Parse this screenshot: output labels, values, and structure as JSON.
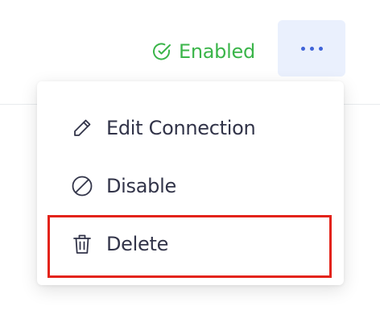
{
  "status": {
    "label": "Enabled",
    "icon": "check-circle-icon",
    "color": "#3bb54a"
  },
  "more_button": {
    "icon": "more-horizontal-icon",
    "accent": "#3f63d8"
  },
  "menu": {
    "items": [
      {
        "label": "Edit Connection",
        "icon": "pencil-icon"
      },
      {
        "label": "Disable",
        "icon": "ban-icon"
      },
      {
        "label": "Delete",
        "icon": "trash-icon"
      }
    ]
  },
  "highlight": {
    "color": "#e3231a",
    "target": "Delete"
  }
}
